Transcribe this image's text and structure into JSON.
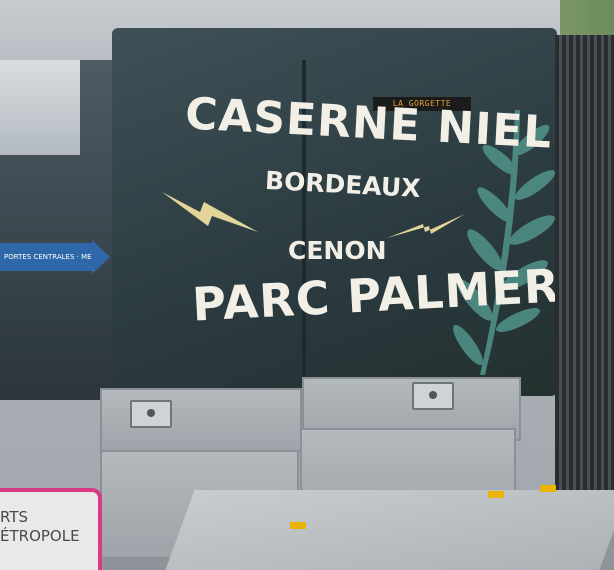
{
  "ad": {
    "line1": "CASERNE NIEL",
    "line2": "BORDEAUX",
    "line3": "CENON",
    "line4": "PARC PALMER"
  },
  "destination_display": "LA GORGETTE",
  "direction_sign": "PORTES CENTRALES · MERO",
  "station_sign": {
    "line1": "RTS",
    "line2": "ÉTROPOLE"
  },
  "colors": {
    "ad_text": "#f2efe6",
    "bolt": "#e3d59a",
    "leaf": "#4f8f86",
    "sign_blue": "#2f68a8",
    "sign_pink": "#d83a86",
    "marker_yellow": "#e8b400"
  },
  "icons": [
    "lightning-bolt-icon",
    "palm-leaf-icon",
    "arrow-right-icon",
    "door-handle-icon"
  ]
}
